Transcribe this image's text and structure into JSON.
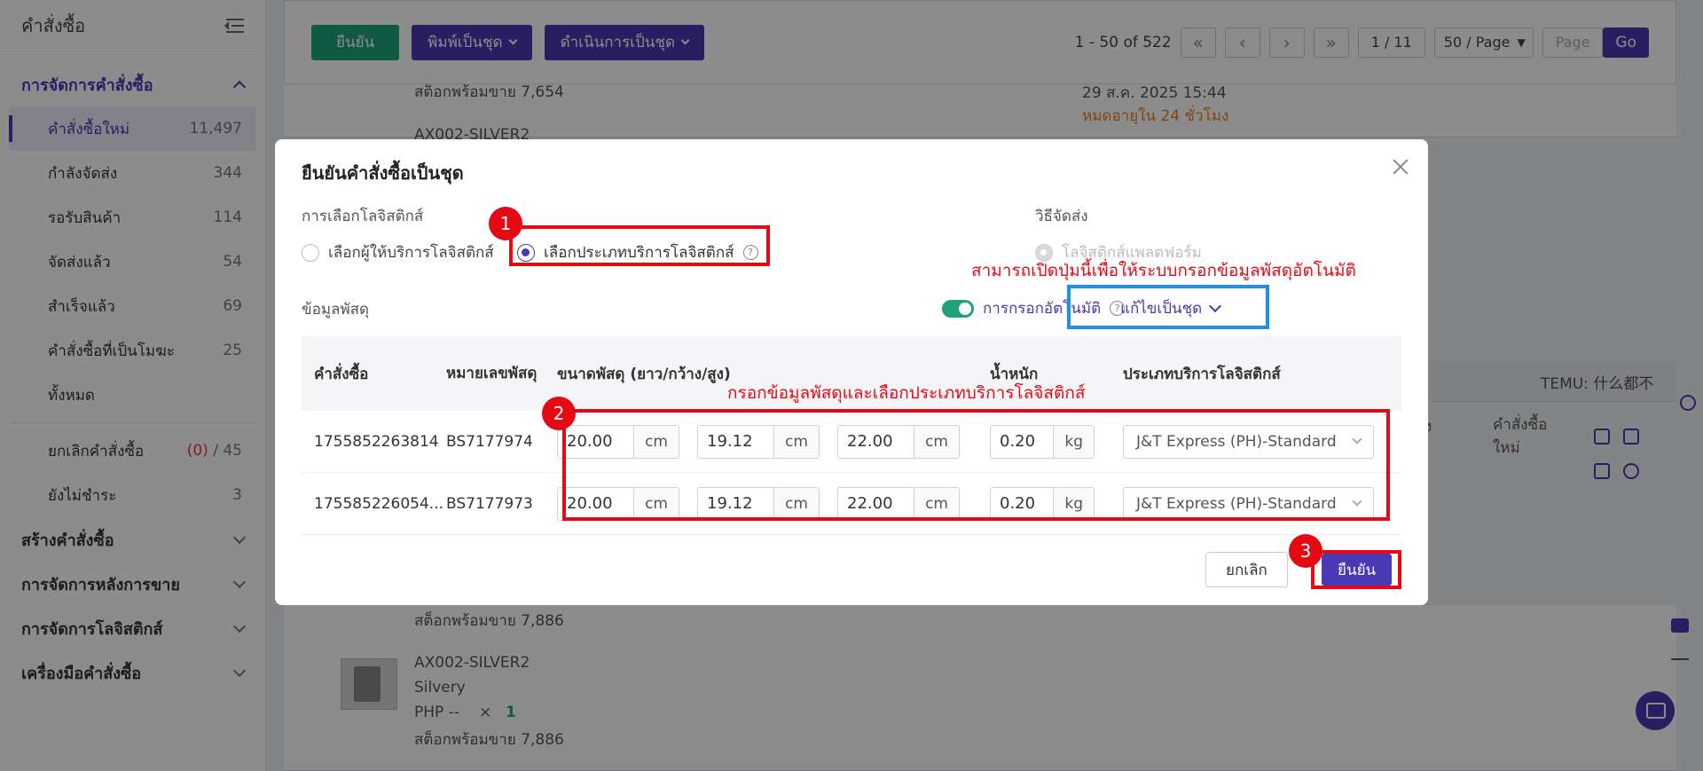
{
  "sidebar": {
    "title": "คำสั่งซื้อ",
    "group_order_mgmt": "การจัดการคำสั่งซื้อ",
    "items": [
      {
        "label": "คำสั่งซื้อใหม่",
        "count": "11,497"
      },
      {
        "label": "กำลังจัดส่ง",
        "count": "344"
      },
      {
        "label": "รอรับสินค้า",
        "count": "114"
      },
      {
        "label": "จัดส่งแล้ว",
        "count": "54"
      },
      {
        "label": "สำเร็จแล้ว",
        "count": "69"
      },
      {
        "label": "คำสั่งซื้อที่เป็นโมฆะ",
        "count": "25"
      },
      {
        "label": "ทั้งหมด",
        "count": ""
      }
    ],
    "cancel_label": "ยกเลิกคำสั่งซื้อ",
    "cancel_red": "(0)",
    "cancel_total": " / 45",
    "unpaid_label": "ยังไม่ชำระ",
    "unpaid_count": "3",
    "groups": [
      "สร้างคำสั่งซื้อ",
      "การจัดการหลังการขาย",
      "การจัดการโลจิสติกส์",
      "เครื่องมือคำสั่งซื้อ"
    ]
  },
  "toolbar": {
    "confirm": "ยืนยัน",
    "print_batch": "พิมพ์เป็นชุด",
    "process_batch": "ดำเนินการเป็นชุด",
    "range": "1 - 50 of 522",
    "page": "1 / 11",
    "page_size": "50 / Page",
    "page_placeholder": "Page",
    "go": "Go"
  },
  "background": {
    "stock1": "สต็อกพร้อมขาย 7,654",
    "sku1": "AX002-SILVER2",
    "date": "29 ส.ค. 2025 15:44",
    "expire": "หมดอายุใน 24 ชั่วโมง",
    "temu": "TEMU: 什么都不",
    "col_tag": "ง",
    "col_new_order": "คำสั่งซื้อ\nใหม่",
    "stock2": "สต็อกพร้อมขาย 7,886",
    "sku2": "AX002-SILVER2",
    "variant": "Silvery",
    "price": "PHP --",
    "times": "×",
    "qty": "1",
    "stock3": "สต็อกพร้อมขาย 7,886"
  },
  "modal": {
    "title": "ยืนยันคำสั่งซื้อเป็นชุด",
    "logistics_select_label": "การเลือกโลจิสติกส์",
    "opt_provider": "เลือกผู้ให้บริการโลจิสติกส์",
    "opt_service_type": "เลือกประเภทบริการโลจิสติกส์",
    "shipping_method_label": "วิธีจัดส่ง",
    "opt_platform": "โลจิสติกส์แพลตฟอร์ม",
    "parcel_info_label": "ข้อมูลพัสดุ",
    "auto_fill": "การกรอกอัตโนมัติ",
    "batch_edit": "แก้ไขเป็นชุด",
    "headers": {
      "order": "คำสั่งซื้อ",
      "tracking": "หมายเลขพัสดุ",
      "size": "ขนาดพัสดุ (ยาว/กว้าง/สูง)",
      "weight": "น้ำหนัก",
      "service": "ประเภทบริการโลจิสติกส์"
    },
    "rows": [
      {
        "order": "1755852263814",
        "tracking": "BS7177974",
        "length": "20.00",
        "width": "19.12",
        "height": "22.00",
        "weight": "0.20",
        "service": "J&T Express (PH)-Standard"
      },
      {
        "order": "175585226054...",
        "tracking": "BS7177973",
        "length": "20.00",
        "width": "19.12",
        "height": "22.00",
        "weight": "0.20",
        "service": "J&T Express (PH)-Standard"
      }
    ],
    "unit_cm": "cm",
    "unit_kg": "kg",
    "cancel": "ยกเลิก",
    "confirm": "ยืนยัน"
  },
  "annotations": {
    "badge1": "1",
    "badge2": "2",
    "badge3": "3",
    "note_toggle": "สามารถเปิดปุ่มนี้เพื่อให้ระบบกรอกข้อมูลพัสดุอัตโนมัติ",
    "note_fill": "กรอกข้อมูลพัสดุและเลือกประเภทบริการโลจิสติกส์"
  },
  "colors": {
    "accent": "#4b38b3",
    "success": "#1ea27a",
    "annotation_red": "#e50914",
    "annotation_blue": "#1e90e8"
  }
}
